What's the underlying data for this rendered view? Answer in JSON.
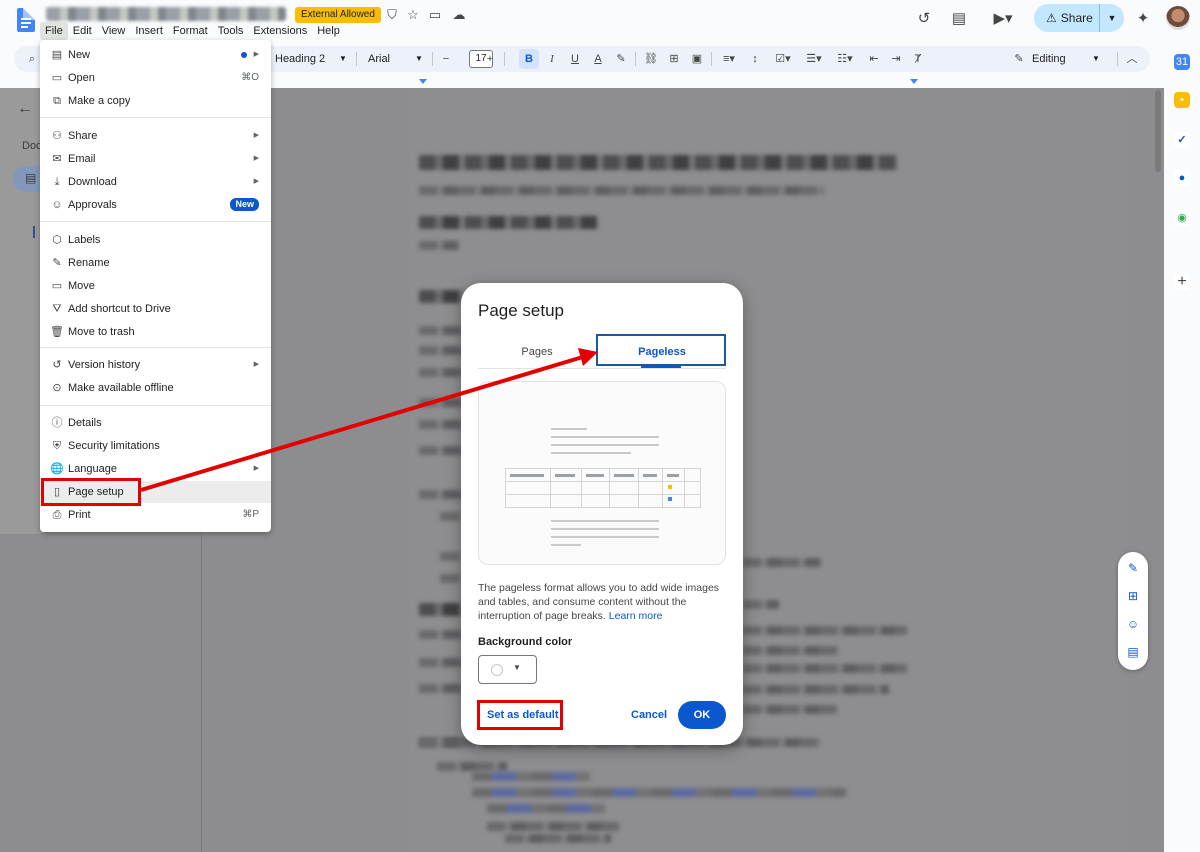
{
  "header": {
    "doc_title_obscured": "",
    "badge": "External Allowed",
    "menus": [
      "File",
      "Edit",
      "View",
      "Insert",
      "Format",
      "Tools",
      "Extensions",
      "Help"
    ],
    "share_label": "Share"
  },
  "toolbar": {
    "style": "Heading 2",
    "font": "Arial",
    "font_size": "17",
    "bold": "B",
    "italic": "I",
    "underline": "U",
    "mode": "Editing"
  },
  "file_menu": {
    "items": [
      {
        "label": "New",
        "icon": "new-doc-icon",
        "glyph": "▤",
        "shortcut": "",
        "submenu": true,
        "dot": true
      },
      {
        "label": "Open",
        "icon": "folder-icon",
        "glyph": "▭",
        "shortcut": "⌘O"
      },
      {
        "label": "Make a copy",
        "icon": "copy-icon",
        "glyph": "⧉",
        "shortcut": ""
      },
      {
        "label": "Share",
        "icon": "person-add-icon",
        "glyph": "⚇",
        "submenu": true
      },
      {
        "label": "Email",
        "icon": "email-icon",
        "glyph": "✉",
        "submenu": true
      },
      {
        "label": "Download",
        "icon": "download-icon",
        "glyph": "⤓",
        "submenu": true
      },
      {
        "label": "Approvals",
        "icon": "approvals-icon",
        "glyph": "☺",
        "badge": "New"
      },
      {
        "label": "Labels",
        "icon": "label-icon",
        "glyph": "⬡"
      },
      {
        "label": "Rename",
        "icon": "pencil-icon",
        "glyph": "✎"
      },
      {
        "label": "Move",
        "icon": "move-folder-icon",
        "glyph": "▭"
      },
      {
        "label": "Add shortcut to Drive",
        "icon": "drive-shortcut-icon",
        "glyph": "⛛"
      },
      {
        "label": "Move to trash",
        "icon": "trash-icon",
        "glyph": "🗑"
      },
      {
        "label": "Version history",
        "icon": "history-icon",
        "glyph": "↺",
        "submenu": true
      },
      {
        "label": "Make available offline",
        "icon": "offline-icon",
        "glyph": "⊙"
      },
      {
        "label": "Details",
        "icon": "info-icon",
        "glyph": "ⓘ"
      },
      {
        "label": "Security limitations",
        "icon": "shield-icon",
        "glyph": "⛨"
      },
      {
        "label": "Language",
        "icon": "globe-icon",
        "glyph": "🌐",
        "submenu": true
      },
      {
        "label": "Page setup",
        "icon": "page-icon",
        "glyph": "▯",
        "highlighted": true
      },
      {
        "label": "Print",
        "icon": "print-icon",
        "glyph": "⎙",
        "shortcut": "⌘P"
      }
    ]
  },
  "outline": {
    "tab_label": "Doc"
  },
  "dialog": {
    "title": "Page setup",
    "tabs": [
      "Pages",
      "Pageless"
    ],
    "active_tab": "Pageless",
    "description": "The pageless format allows you to add wide images and tables, and consume content without the interruption of page breaks.",
    "learn_more": "Learn more",
    "background_label": "Background color",
    "background_value": "#ffffff",
    "set_default": "Set as default",
    "cancel": "Cancel",
    "ok": "OK"
  },
  "colors": {
    "accent": "#0b57d0",
    "annotation_red": "#e30000",
    "badge_yellow": "#fbbc04",
    "share_bg": "#c2e7ff"
  }
}
